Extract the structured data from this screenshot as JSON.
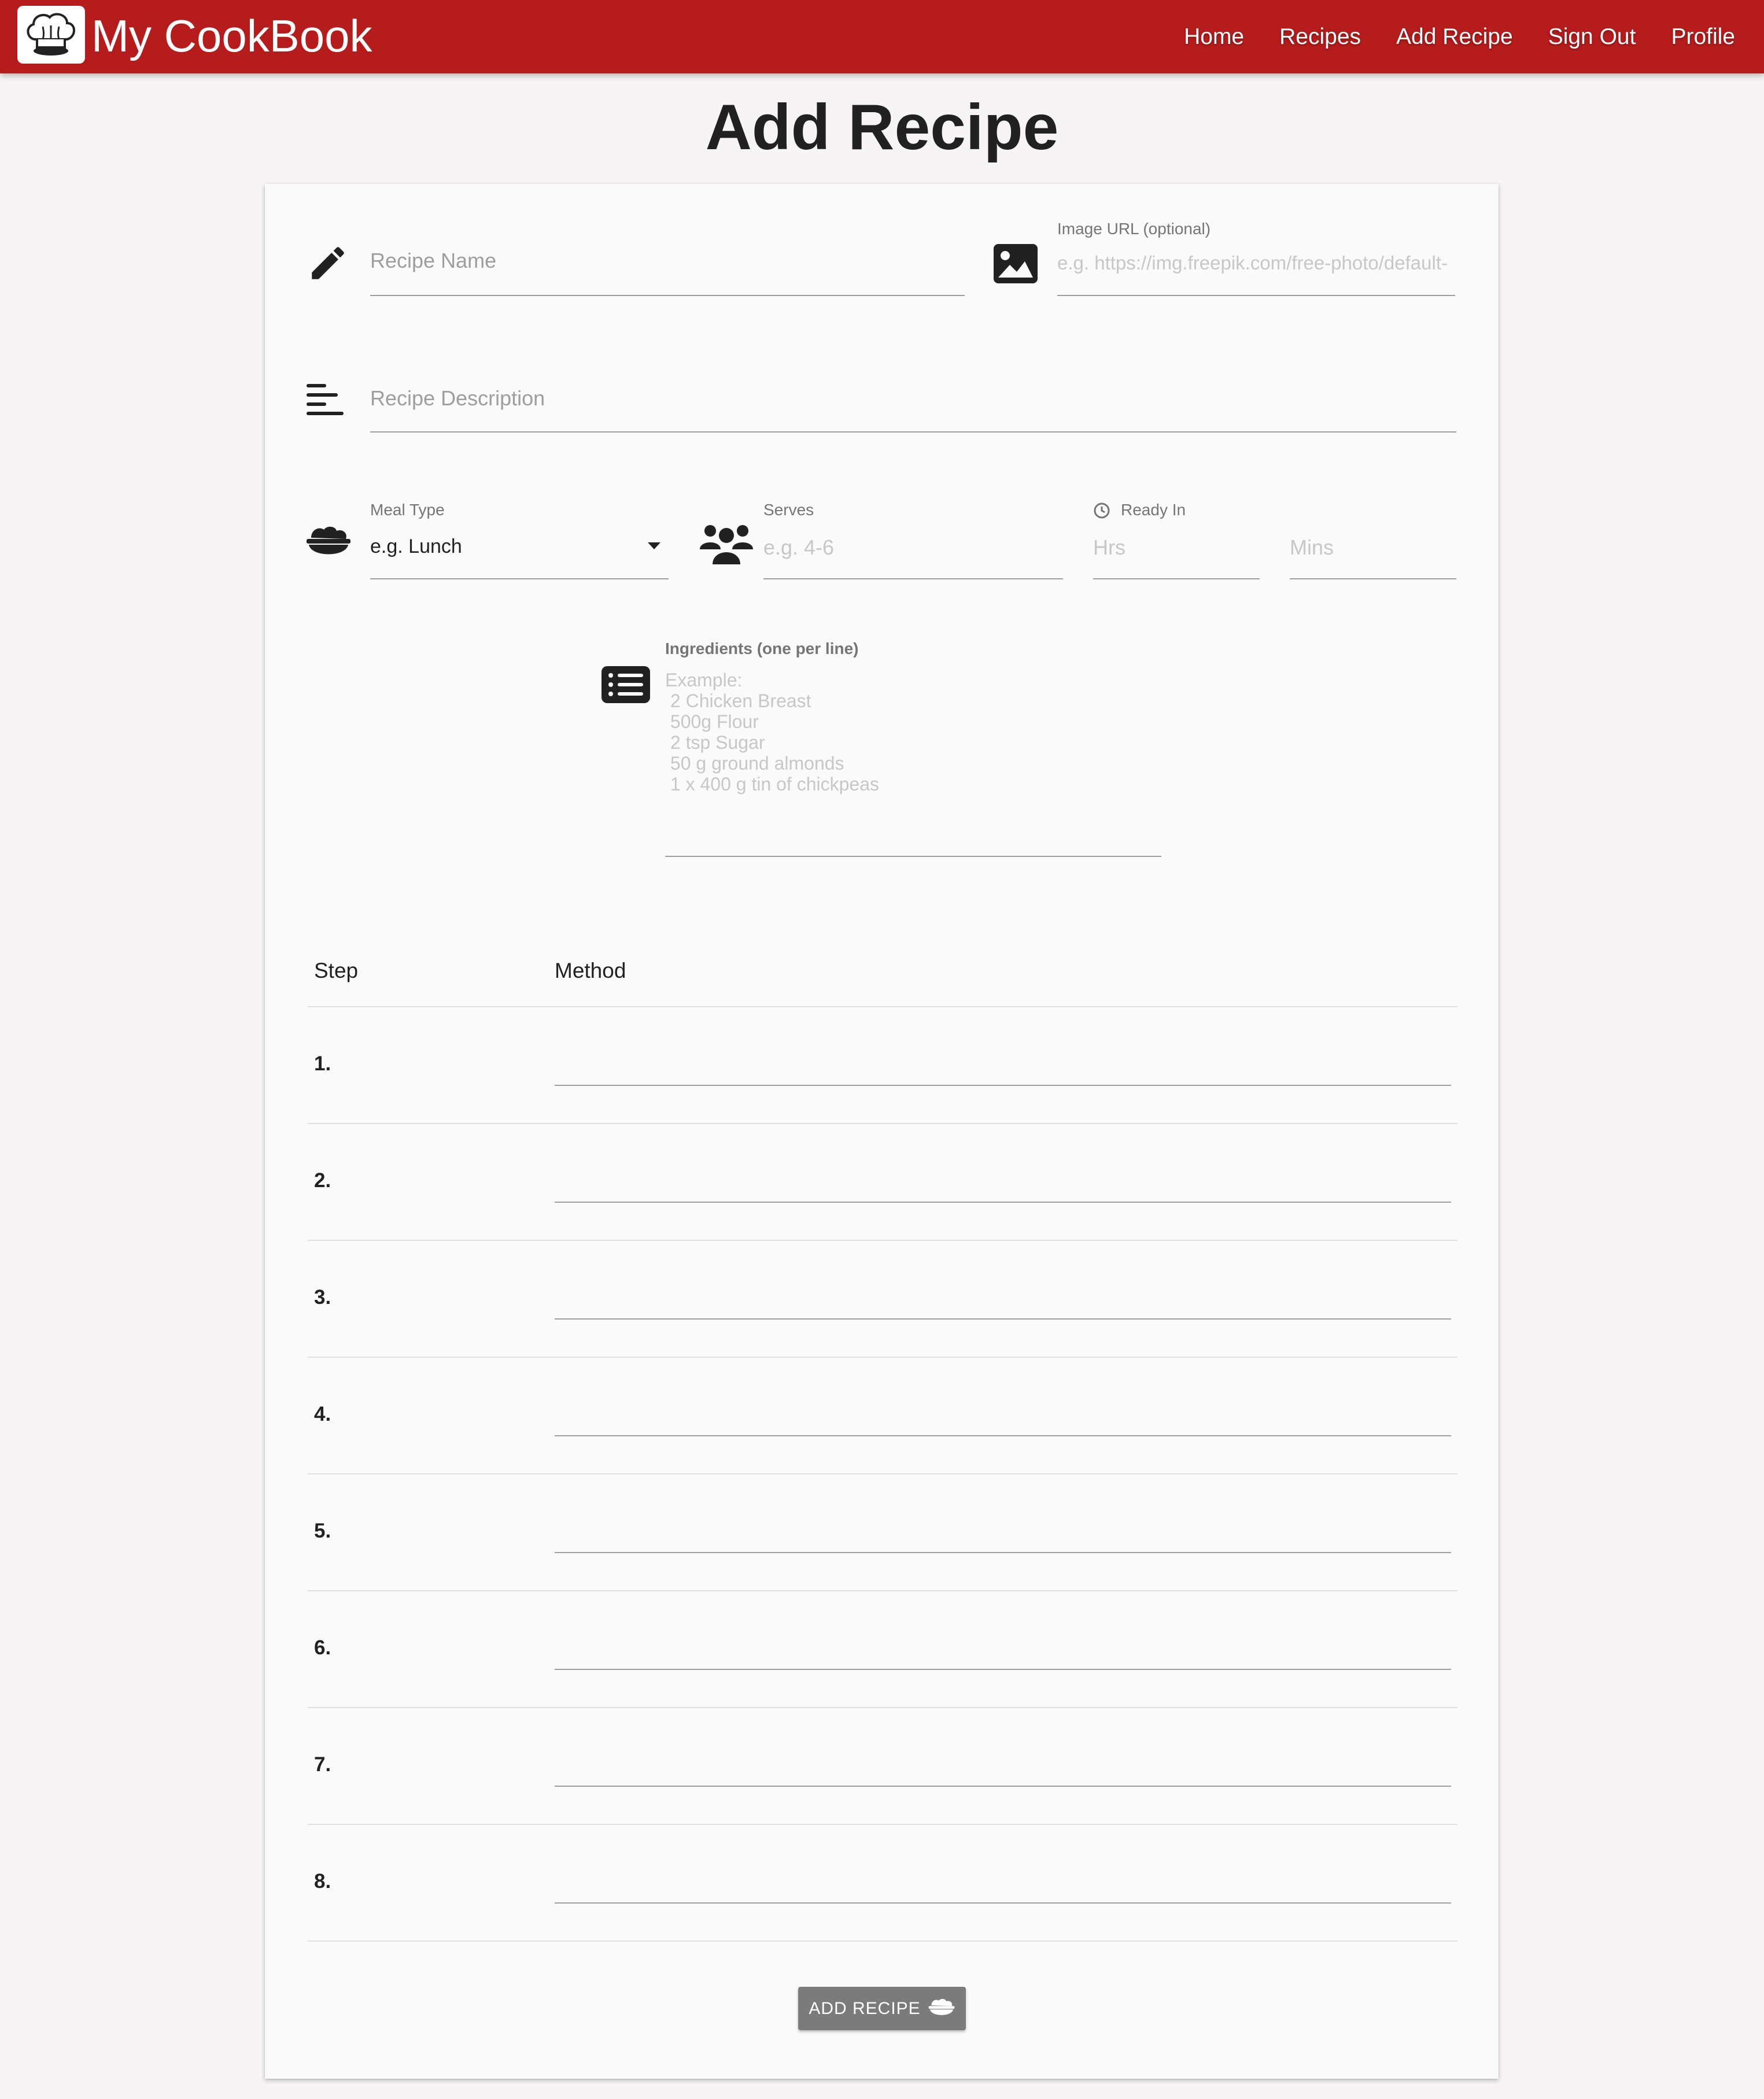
{
  "navbar": {
    "brand": "My CookBook",
    "links": [
      "Home",
      "Recipes",
      "Add Recipe",
      "Sign Out",
      "Profile"
    ]
  },
  "page": {
    "title": "Add Recipe"
  },
  "form": {
    "recipe_name": {
      "placeholder": "Recipe Name"
    },
    "image_url": {
      "label": "Image URL (optional)",
      "placeholder": "e.g. https://img.freepik.com/free-photo/default-"
    },
    "description": {
      "placeholder": "Recipe Description"
    },
    "meal_type": {
      "label": "Meal Type",
      "value": "e.g. Lunch"
    },
    "serves": {
      "label": "Serves",
      "placeholder": "e.g. 4-6"
    },
    "ready_in": {
      "label": "Ready In",
      "hrs_placeholder": "Hrs",
      "mins_placeholder": "Mins"
    },
    "ingredients": {
      "label": "Ingredients (one per line)",
      "placeholder_lines": [
        "Example:",
        " 2 Chicken Breast",
        " 500g Flour",
        " 2 tsp Sugar",
        " 50 g ground almonds",
        " 1 x 400 g tin of chickpeas"
      ]
    },
    "method_table": {
      "headers": [
        "Step",
        "Method"
      ],
      "steps": [
        "1.",
        "2.",
        "3.",
        "4.",
        "5.",
        "6.",
        "7.",
        "8."
      ]
    },
    "submit_label": "ADD RECIPE"
  },
  "icons": [
    "chef-hat-icon",
    "pencil-icon",
    "image-icon",
    "align-left-icon",
    "bowl-icon",
    "users-icon",
    "clock-icon",
    "dropdown-caret-icon",
    "list-icon"
  ],
  "colors": {
    "navbar": "#b71c1c",
    "button": "#7b7b7b"
  }
}
